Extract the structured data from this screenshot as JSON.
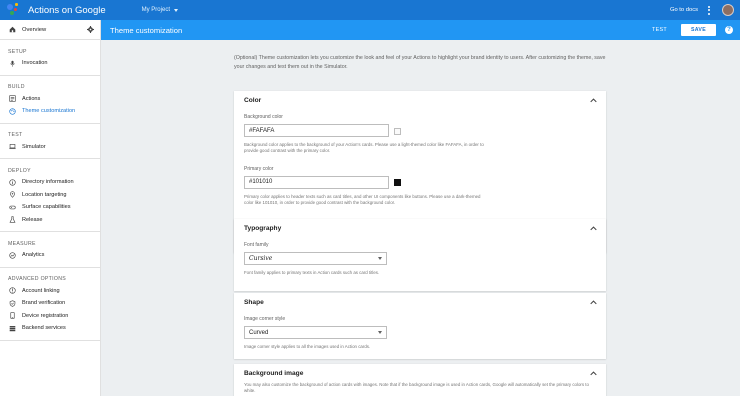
{
  "topbar": {
    "brand": "Actions on Google",
    "project": "My Project",
    "docs_link": "Go to docs"
  },
  "sidebar": {
    "overview": "Overview",
    "sections": [
      {
        "title": "SETUP",
        "items": [
          {
            "label": "Invocation",
            "icon": "mic-icon"
          }
        ]
      },
      {
        "title": "BUILD",
        "items": [
          {
            "label": "Actions",
            "icon": "list-icon"
          },
          {
            "label": "Theme customization",
            "icon": "palette-icon",
            "active": true
          }
        ]
      },
      {
        "title": "TEST",
        "items": [
          {
            "label": "Simulator",
            "icon": "laptop-icon"
          }
        ]
      },
      {
        "title": "DEPLOY",
        "items": [
          {
            "label": "Directory information",
            "icon": "info-icon"
          },
          {
            "label": "Location targeting",
            "icon": "location-icon"
          },
          {
            "label": "Surface capabilities",
            "icon": "devices-icon"
          },
          {
            "label": "Release",
            "icon": "flask-icon"
          }
        ]
      },
      {
        "title": "MEASURE",
        "items": [
          {
            "label": "Analytics",
            "icon": "analytics-icon"
          }
        ]
      },
      {
        "title": "ADVANCED OPTIONS",
        "items": [
          {
            "label": "Account linking",
            "icon": "link-icon"
          },
          {
            "label": "Brand verification",
            "icon": "shield-icon"
          },
          {
            "label": "Device registration",
            "icon": "phone-icon"
          },
          {
            "label": "Backend services",
            "icon": "storage-icon"
          }
        ]
      }
    ]
  },
  "header": {
    "title": "Theme customization",
    "test_label": "TEST",
    "save_label": "SAVE",
    "help_label": "?"
  },
  "intro": "(Optional) Theme customization lets you customize the look and feel of your Actions to highlight your brand identity to users. After customizing the theme, save your changes and test them out in the Simulator.",
  "color_card": {
    "title": "Color",
    "background": {
      "label": "Background color",
      "value": "#FAFAFA",
      "swatch": "#fafafa",
      "help": "Background color applies to the background of your Action's cards. Please use a light-themed color like FAFAFA, in order to provide good contrast with the primary color."
    },
    "primary": {
      "label": "Primary color",
      "value": "#101010",
      "swatch": "#101010",
      "help": "Primary color applies to header texts such as card titles, and other UI components like buttons. Please use a dark-themed color like 101010, in order to provide good contrast with the background color."
    }
  },
  "typography_card": {
    "title": "Typography",
    "label": "Font family",
    "value": "Cursive",
    "help": "Font family applies to primary texts in Action cards such as card titles."
  },
  "shape_card": {
    "title": "Shape",
    "label": "Image corner style",
    "value": "Curved",
    "help": "Image corner style applies to all the images used in Action cards."
  },
  "background_image_card": {
    "title": "Background image",
    "help": "You may also customize the background of action cards with images. Note that if the background image is used in Action cards, Google will automatically set the primary colors to white."
  },
  "colors": {
    "topbar": "#1976d2",
    "band": "#2196f3",
    "accent": "#1976d2"
  }
}
